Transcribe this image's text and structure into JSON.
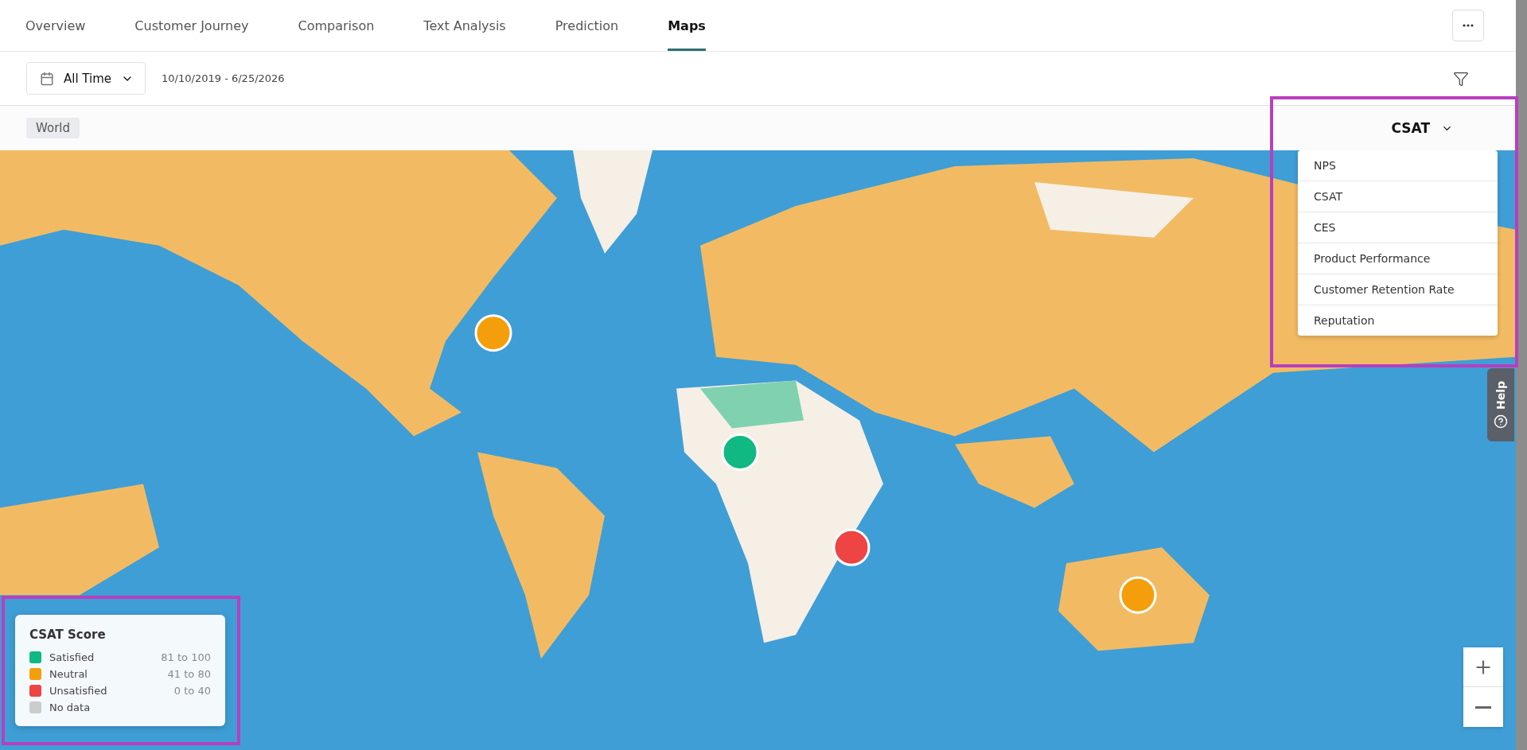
{
  "tabs": [
    {
      "label": "Overview",
      "selected": false
    },
    {
      "label": "Customer Journey",
      "selected": false
    },
    {
      "label": "Comparison",
      "selected": false
    },
    {
      "label": "Text Analysis",
      "selected": false
    },
    {
      "label": "Prediction",
      "selected": false
    },
    {
      "label": "Maps",
      "selected": true
    }
  ],
  "date_filter": {
    "value": "All Time",
    "range": "10/10/2019 - 6/25/2026"
  },
  "breadcrumb": "World",
  "metric_select": {
    "value": "CSAT",
    "expanded": true,
    "options": [
      {
        "label": "NPS"
      },
      {
        "label": "CSAT"
      },
      {
        "label": "CES"
      },
      {
        "label": "Product Performance"
      },
      {
        "label": "Customer Retention Rate"
      },
      {
        "label": "Reputation"
      }
    ]
  },
  "legend": {
    "title": "CSAT Score",
    "items": [
      {
        "label": "Satisfied",
        "range": "81 to 100",
        "color": "#10b981"
      },
      {
        "label": "Neutral",
        "range": "41 to 80",
        "color": "#f59e0b"
      },
      {
        "label": "Unsatisfied",
        "range": "0 to 40",
        "color": "#ef4444"
      },
      {
        "label": "No data",
        "color": "#cccccc"
      }
    ]
  },
  "help": {
    "label": "Help"
  }
}
